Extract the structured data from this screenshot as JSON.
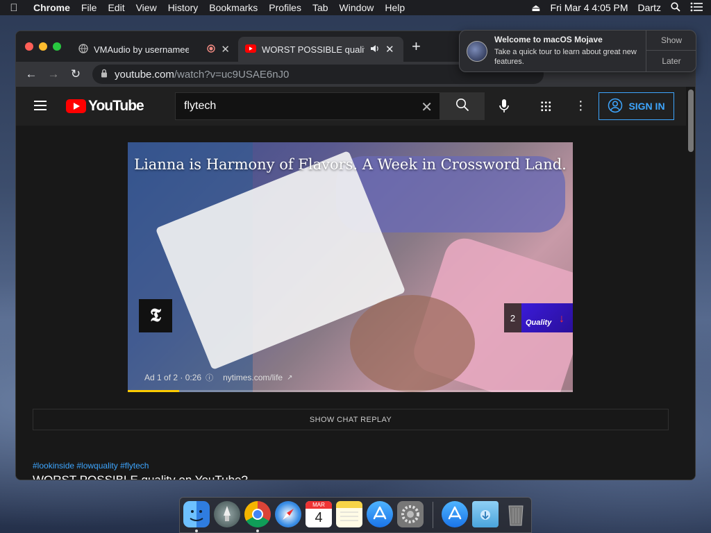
{
  "menubar": {
    "app_name": "Chrome",
    "menus": [
      "File",
      "Edit",
      "View",
      "History",
      "Bookmarks",
      "Profiles",
      "Tab",
      "Window",
      "Help"
    ],
    "datetime": "Fri Mar 4  4:05 PM",
    "user": "Dartz"
  },
  "browser": {
    "tabs": [
      {
        "title": "VMAudio by usernamee"
      },
      {
        "title": "WORST POSSIBLE quality o"
      }
    ],
    "url_host": "youtube.com",
    "url_path": "/watch?v=uc9USAE6nJ0"
  },
  "youtube": {
    "logo_text": "YouTube",
    "search_value": "flytech",
    "sign_in_label": "SIGN IN",
    "ad": {
      "headline": "Lianna is Harmony of Flavors. A Week in Crossword Land.",
      "brand_glyph": "𝕿",
      "skip_count": "2",
      "thumb_label": "Quality",
      "ad_counter": "Ad 1 of 2 · 0:26",
      "ad_link": "nytimes.com/life",
      "progress": 0.115
    },
    "chat_replay_label": "SHOW CHAT REPLAY",
    "hashtags": "#lookinside #lowquality #flytech",
    "video_title": "WORST POSSIBLE quality on YouTube?"
  },
  "notification": {
    "title": "Welcome to macOS Mojave",
    "body": "Take a quick tour to learn about great new features.",
    "show_label": "Show",
    "later_label": "Later"
  },
  "dock": {
    "calendar_month": "MAR",
    "calendar_day": "4"
  },
  "colors": {
    "youtube_red": "#ff0000",
    "link_blue": "#3ea6ff",
    "ad_progress": "#ffcc00"
  }
}
